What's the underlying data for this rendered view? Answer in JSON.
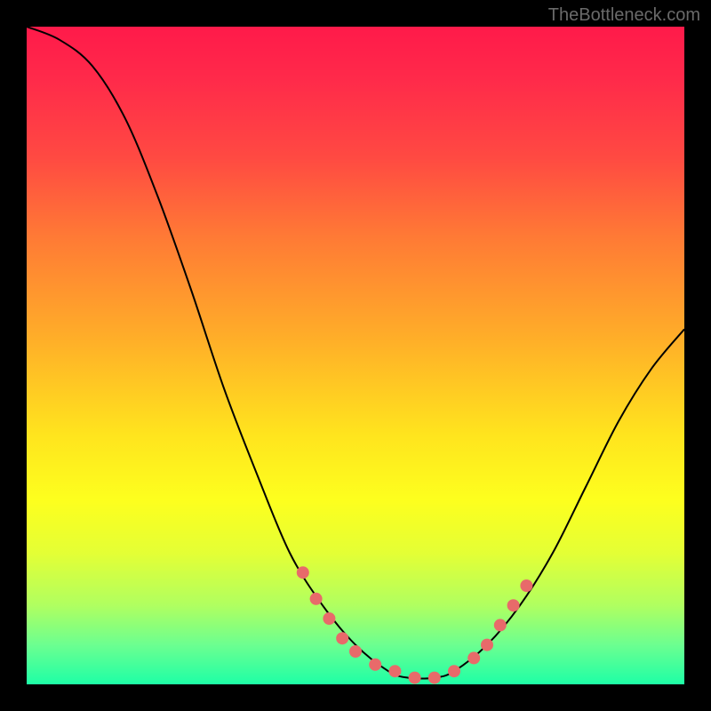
{
  "watermark": "TheBottleneck.com",
  "chart_data": {
    "type": "line",
    "title": "",
    "xlabel": "",
    "ylabel": "",
    "xlim": [
      0,
      100
    ],
    "ylim": [
      0,
      100
    ],
    "curve": [
      {
        "x": 0,
        "y": 100
      },
      {
        "x": 5,
        "y": 98
      },
      {
        "x": 10,
        "y": 94
      },
      {
        "x": 15,
        "y": 86
      },
      {
        "x": 20,
        "y": 74
      },
      {
        "x": 25,
        "y": 60
      },
      {
        "x": 30,
        "y": 45
      },
      {
        "x": 35,
        "y": 32
      },
      {
        "x": 40,
        "y": 20
      },
      {
        "x": 45,
        "y": 12
      },
      {
        "x": 50,
        "y": 6
      },
      {
        "x": 55,
        "y": 2
      },
      {
        "x": 58,
        "y": 1
      },
      {
        "x": 62,
        "y": 1
      },
      {
        "x": 65,
        "y": 2
      },
      {
        "x": 70,
        "y": 6
      },
      {
        "x": 75,
        "y": 12
      },
      {
        "x": 80,
        "y": 20
      },
      {
        "x": 85,
        "y": 30
      },
      {
        "x": 90,
        "y": 40
      },
      {
        "x": 95,
        "y": 48
      },
      {
        "x": 100,
        "y": 54
      }
    ],
    "markers": [
      {
        "x": 42,
        "y": 17
      },
      {
        "x": 44,
        "y": 13
      },
      {
        "x": 46,
        "y": 10
      },
      {
        "x": 48,
        "y": 7
      },
      {
        "x": 50,
        "y": 5
      },
      {
        "x": 53,
        "y": 3
      },
      {
        "x": 56,
        "y": 2
      },
      {
        "x": 59,
        "y": 1
      },
      {
        "x": 62,
        "y": 1
      },
      {
        "x": 65,
        "y": 2
      },
      {
        "x": 68,
        "y": 4
      },
      {
        "x": 70,
        "y": 6
      },
      {
        "x": 72,
        "y": 9
      },
      {
        "x": 74,
        "y": 12
      },
      {
        "x": 76,
        "y": 15
      }
    ],
    "colors": {
      "curve": "#000000",
      "marker": "#e86a6a",
      "gradient_top": "#ff1a4a",
      "gradient_bottom": "#1effa6"
    }
  }
}
